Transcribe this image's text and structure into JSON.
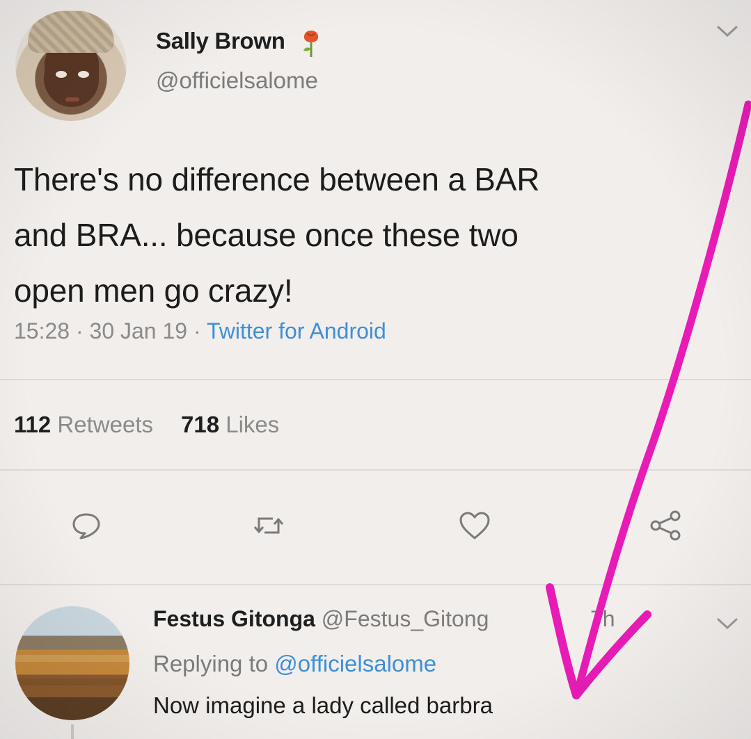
{
  "tweet": {
    "author_name": "Sally Brown",
    "author_handle": "@officielsalome",
    "text_lines": [
      "There's no difference between a BAR",
      "and BRA... because once these two",
      "open men go crazy!"
    ],
    "time": "15:28",
    "date": "30 Jan 19",
    "source": "Twitter for Android",
    "retweets_count": "112",
    "retweets_label": "Retweets",
    "likes_count": "718",
    "likes_label": "Likes"
  },
  "reply": {
    "author_name": "Festus Gitonga",
    "author_handle": "@Festus_Gitong",
    "time": "7h",
    "replying_prefix": "Replying to",
    "replying_to": "@officielsalome",
    "text": "Now imagine a lady called barbra"
  },
  "colors": {
    "link_blue": "#3e8fd6",
    "annotation_pink": "#e81bb6",
    "icon_gray": "#7a7a7a"
  },
  "icons": {
    "author_emoji": "rose-icon",
    "actions": [
      "reply-icon",
      "retweet-icon",
      "like-icon",
      "share-icon"
    ],
    "menu": "chevron-down-icon",
    "annotation": "arrow-annotation"
  }
}
